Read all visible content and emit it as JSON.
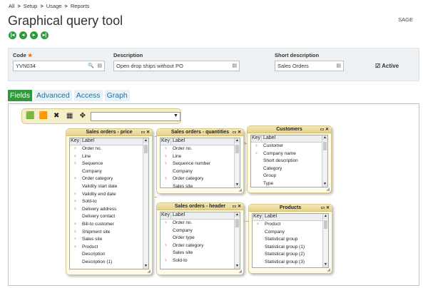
{
  "breadcrumb": {
    "items": [
      "All",
      "Setup",
      "Usage",
      "Reports"
    ]
  },
  "site": "SAGE",
  "page_title": "Graphical query tool",
  "fields": {
    "code_label": "Code",
    "code_value": "YVN034",
    "description_label": "Description",
    "description_value": "Open drop ships without PO",
    "short_label": "Short description",
    "short_value": "Sales Orders",
    "active_label": "Active"
  },
  "tabs": [
    "Fields",
    "Advanced",
    "Access",
    "Graph"
  ],
  "tables": {
    "price": {
      "title": "Sales orders - price",
      "rows": [
        {
          "k": "key",
          "l": "Order no."
        },
        {
          "k": "key",
          "l": "Line"
        },
        {
          "k": "key",
          "l": "Sequence"
        },
        {
          "k": "",
          "l": "Company"
        },
        {
          "k": "key",
          "l": "Order category"
        },
        {
          "k": "",
          "l": "Validity start date"
        },
        {
          "k": "key",
          "l": "Validity end date"
        },
        {
          "k": "key",
          "l": "Sold-to"
        },
        {
          "k": "key",
          "l": "Delivery address"
        },
        {
          "k": "",
          "l": "Delivery contact"
        },
        {
          "k": "key",
          "l": "Bill-to customer"
        },
        {
          "k": "key",
          "l": "Shipment site"
        },
        {
          "k": "key",
          "l": "Sales site"
        },
        {
          "k": "key",
          "l": "Product"
        },
        {
          "k": "",
          "l": "Description"
        },
        {
          "k": "",
          "l": "Description (1)"
        }
      ]
    },
    "qty": {
      "title": "Sales orders - quantities",
      "rows": [
        {
          "k": "key",
          "l": "Order no."
        },
        {
          "k": "key",
          "l": "Line"
        },
        {
          "k": "key",
          "l": "Sequence number"
        },
        {
          "k": "",
          "l": "Company"
        },
        {
          "k": "key",
          "l": "Order category"
        },
        {
          "k": "",
          "l": "Sales site"
        }
      ]
    },
    "customers": {
      "title": "Customers",
      "rows": [
        {
          "k": "key",
          "l": "Customer"
        },
        {
          "k": "key",
          "l": "Company name"
        },
        {
          "k": "",
          "l": "Short description"
        },
        {
          "k": "",
          "l": "Category"
        },
        {
          "k": "",
          "l": "Group"
        },
        {
          "k": "",
          "l": "Type"
        }
      ]
    },
    "header": {
      "title": "Sales orders - header",
      "rows": [
        {
          "k": "key",
          "l": "Order no."
        },
        {
          "k": "",
          "l": "Company"
        },
        {
          "k": "",
          "l": "Order type"
        },
        {
          "k": "key",
          "l": "Order category"
        },
        {
          "k": "",
          "l": "Sales site"
        },
        {
          "k": "key",
          "l": "Sold-to"
        }
      ]
    },
    "products": {
      "title": "Products",
      "rows": [
        {
          "k": "key",
          "l": "Product"
        },
        {
          "k": "",
          "l": "Company"
        },
        {
          "k": "",
          "l": "Statistical group"
        },
        {
          "k": "",
          "l": "Statistical group (1)"
        },
        {
          "k": "",
          "l": "Statistical group (2)"
        },
        {
          "k": "",
          "l": "Statistical group (3)"
        }
      ]
    }
  },
  "table_header": {
    "key": "Key",
    "label": "Label"
  }
}
